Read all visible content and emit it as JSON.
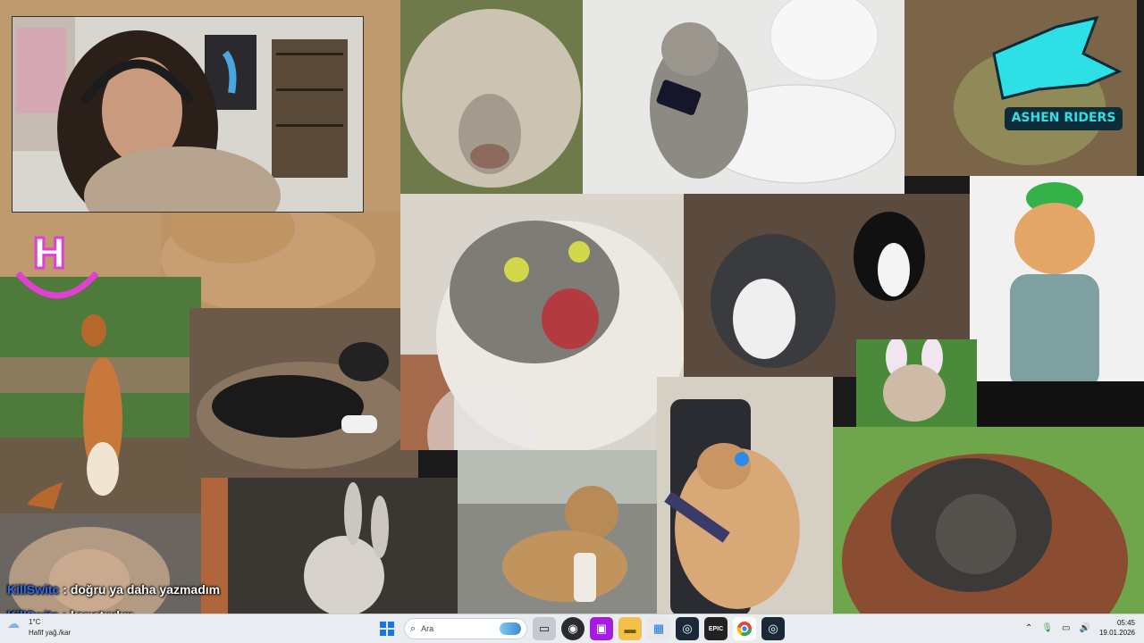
{
  "chat": [
    {
      "user": "KillSwitc",
      "sep": " : ",
      "message": "doğru ya daha yazmadım"
    },
    {
      "user": "KillSwitc",
      "sep": " : ",
      "message": "karıştırdım"
    }
  ],
  "logo": {
    "text": "ASHEN RIDERS",
    "color": "#2de0e6"
  },
  "hi_sticker": {
    "color": "#e23fd6"
  },
  "taskbar": {
    "weather_temp": "1°C",
    "weather_desc": "Hafif yağ./kar",
    "search_placeholder": "Ara",
    "icons": [
      "windows-start-icon",
      "search-icon",
      "task-view-icon",
      "obs-icon",
      "twitch-icon",
      "file-explorer-icon",
      "store-icon",
      "steam-icon",
      "epic-games-icon",
      "chrome-icon",
      "steam-icon-2"
    ],
    "time": "05:45",
    "date": "19.01.2026"
  },
  "colors": {
    "taskbar_bg": "#e9ecf1",
    "chat_user": "#2e6cf0",
    "twitch_purple": "#a41ce0"
  }
}
